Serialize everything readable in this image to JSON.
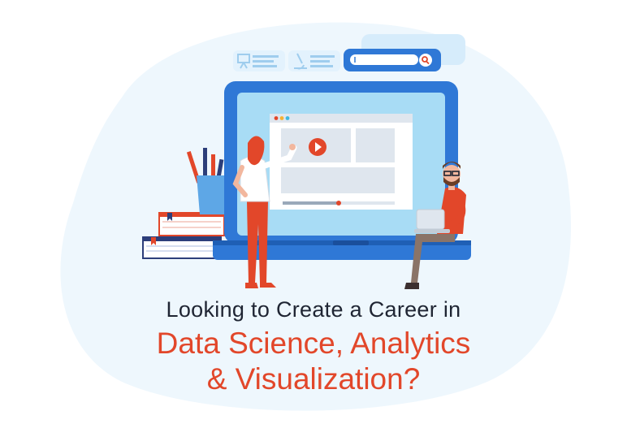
{
  "headline": {
    "line1": "Looking to Create a Career in",
    "line2": "Data Science, Analytics",
    "line3": "& Visualization?"
  },
  "colors": {
    "background_blob": "#eef7fd",
    "laptop_frame": "#2f78d6",
    "screen": "#a8dcf5",
    "accent_red": "#e2472a",
    "text_dark": "#1f2533"
  },
  "icons": [
    "presentation-board-icon",
    "microscope-icon",
    "search-icon",
    "play-icon"
  ],
  "video": {
    "progress": 0.5
  }
}
